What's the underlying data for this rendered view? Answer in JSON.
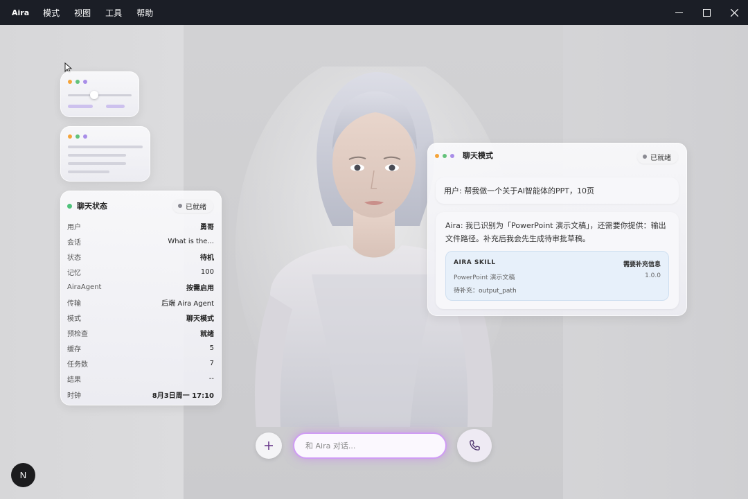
{
  "app": {
    "title": "Aira",
    "menu": [
      "模式",
      "视图",
      "工具",
      "帮助"
    ]
  },
  "window_controls": [
    "minimize-icon",
    "maximize-icon",
    "close-icon"
  ],
  "status_card": {
    "title": "聊天状态",
    "badge": "已就绪",
    "rows": [
      {
        "k": "用户",
        "v": "勇哥"
      },
      {
        "k": "会话",
        "v": "What is the..."
      },
      {
        "k": "状态",
        "v": "待机"
      },
      {
        "k": "记忆",
        "v": "100"
      },
      {
        "k": "AiraAgent",
        "v": "按需启用"
      },
      {
        "k": "传输",
        "v": "后端 Aira Agent"
      },
      {
        "k": "模式",
        "v": "聊天模式"
      },
      {
        "k": "预检查",
        "v": "就绪"
      },
      {
        "k": "缓存",
        "v": "5"
      },
      {
        "k": "任务数",
        "v": "7"
      },
      {
        "k": "结果",
        "v": "--"
      },
      {
        "k": "时钟",
        "v": "8月3日周一 17:10"
      }
    ]
  },
  "chat_card": {
    "title": "聊天模式",
    "badge": "已就绪",
    "user_message": "用户: 帮我做一个关于AI智能体的PPT，10页",
    "ai_message": "Aira: 我已识别为「PowerPoint 演示文稿」，还需要你提供：输出文件路径。补充后我会先生成待审批草稿。",
    "skill": {
      "name": "AIRA SKILL",
      "status": "需要补充信息",
      "type": "PowerPoint 演示文稿",
      "version": "1.0.0",
      "missing": "待补充：output_path"
    }
  },
  "composer": {
    "placeholder": "和 Aira 对话..."
  },
  "corner_badge": "N",
  "colors": {
    "accent": "#cf9cf4",
    "ready_dot": "#4ec27a",
    "title_bar": "#1b1e26"
  }
}
